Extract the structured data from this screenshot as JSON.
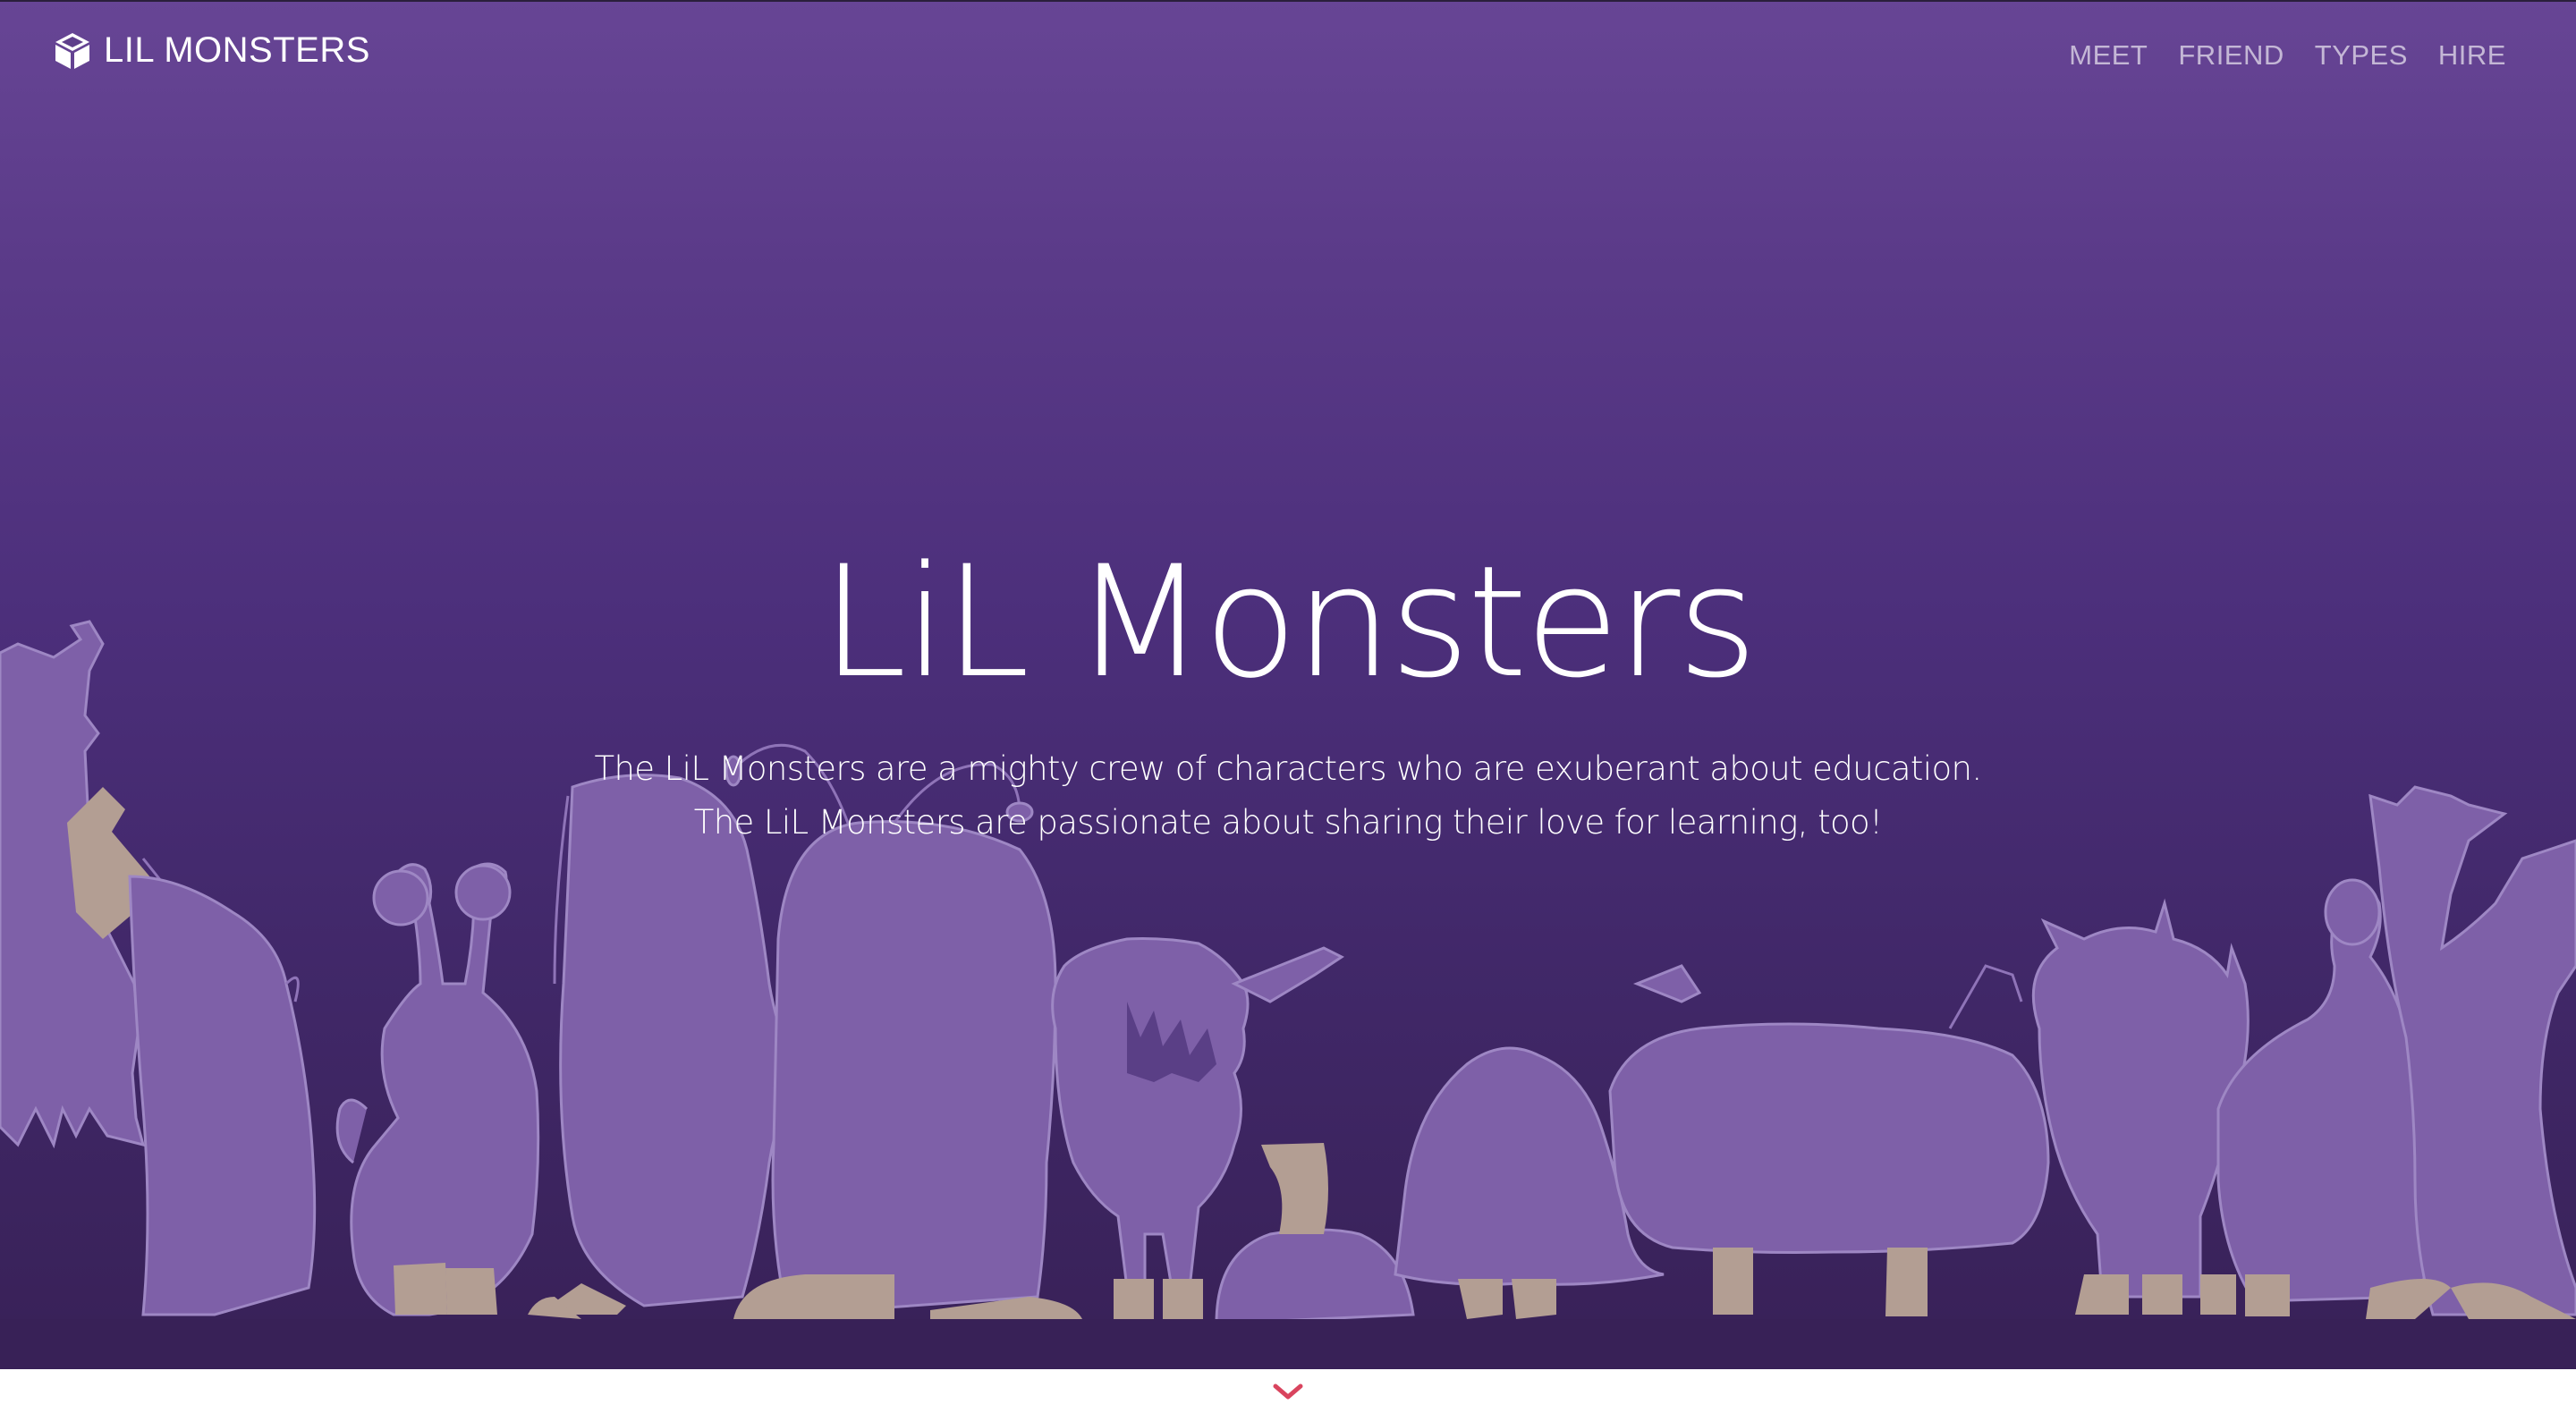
{
  "navbar": {
    "brand_label": "LIL MONSTERS",
    "brand_icon": "cube-icon",
    "links": [
      {
        "label": "MEET"
      },
      {
        "label": "FRIEND"
      },
      {
        "label": "TYPES"
      },
      {
        "label": "HIRE"
      }
    ]
  },
  "hero": {
    "title": "LiL Monsters",
    "subtitle_line_1": "The LiL Monsters are a mighty crew of characters who are exuberant about education.",
    "subtitle_line_2": "The LiL Monsters are passionate about sharing their love for learning, too!",
    "illustration": "monster-silhouettes"
  },
  "scroll_indicator": {
    "icon": "chevron-down-icon"
  },
  "colors": {
    "hero_top": "#674595",
    "hero_bottom": "#382157",
    "monster_fill": "#7e60a8",
    "monster_outline": "#9d85c3",
    "monster_feet": "#b39e93",
    "chevron": "#d9445e",
    "nav_text": "#c4b7dc"
  }
}
